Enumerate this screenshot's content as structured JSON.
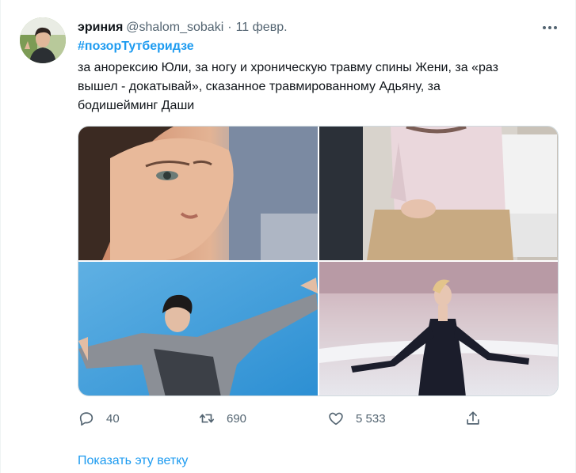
{
  "tweet": {
    "author_name": "эриния",
    "author_handle": "@shalom_sobaki",
    "separator": "·",
    "date": "11 февр.",
    "hashtag": "#позорТутберидзе",
    "text_lines": [
      "за анорексию Юли, за ногу и хроническую травму спины Жени, за «раз",
      "вышел - докатывай», сказанное травмированному Адьяну, за",
      "бодишейминг Даши"
    ],
    "media": [
      {
        "icon": "face-closeup-photo"
      },
      {
        "icon": "seated-person-photo"
      },
      {
        "icon": "male-skater-photo"
      },
      {
        "icon": "female-skater-photo"
      }
    ],
    "actions": {
      "replies": "40",
      "retweets": "690",
      "likes": "5 533"
    },
    "show_thread": "Показать эту ветку"
  },
  "colors": {
    "link": "#1d9bf0",
    "secondary_text": "#536471",
    "primary_text": "#0f1419",
    "border": "#cfd9de"
  }
}
